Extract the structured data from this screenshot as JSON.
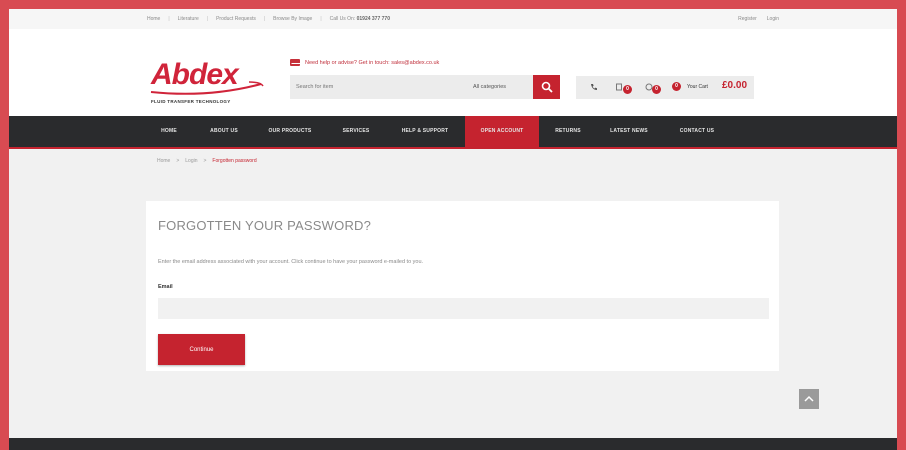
{
  "topbar": {
    "links": [
      "Home",
      "Literature",
      "Product Requests",
      "Browse By Image"
    ],
    "call_label": "Call Us On:",
    "phone": "01924 377 770",
    "register": "Register",
    "login": "Login"
  },
  "header": {
    "logo_text": "Abdex",
    "logo_tagline": "FLUID TRANSFER TECHNOLOGY",
    "help_text": "Need help or advise? Get in touch: sales@abdex.co.uk",
    "search_placeholder": "Search for item",
    "category_label": "All categories",
    "cart_label": "Your Cart",
    "cart_total": "£0.00",
    "badges": [
      "0",
      "0",
      "0"
    ]
  },
  "nav": {
    "items": [
      "HOME",
      "ABOUT US",
      "OUR PRODUCTS",
      "SERVICES",
      "HELP & SUPPORT",
      "OPEN ACCOUNT",
      "RETURNS",
      "LATEST NEWS",
      "CONTACT US"
    ],
    "active_index": 5
  },
  "breadcrumb": [
    "Home",
    "Login",
    "Forgotten password"
  ],
  "form": {
    "title": "FORGOTTEN YOUR PASSWORD?",
    "description": "Enter the email address associated with your account. Click continue to have your password e-mailed to you.",
    "email_label": "Email",
    "email_value": "",
    "continue_label": "Continue"
  },
  "colors": {
    "brand": "#c5232f",
    "nav_bg": "#2a2b2d",
    "frame": "#d84b52"
  }
}
